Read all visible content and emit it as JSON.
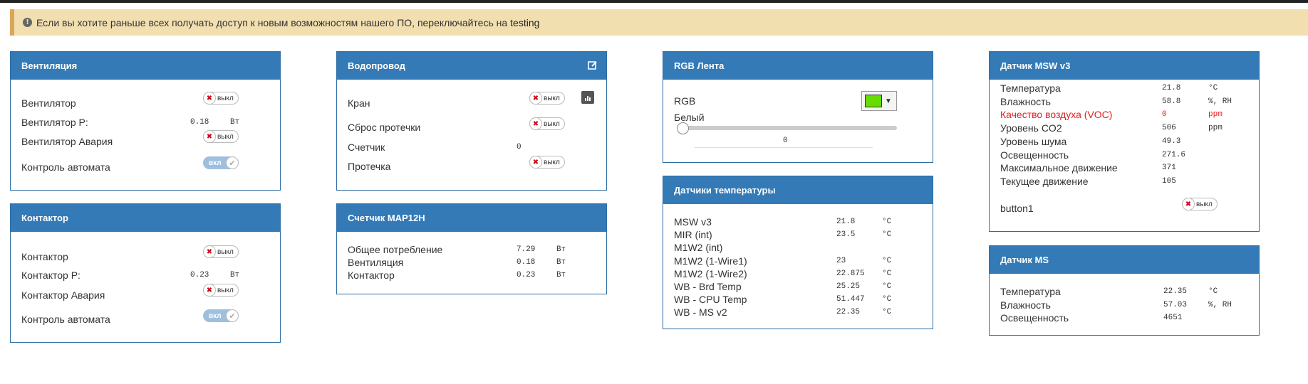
{
  "alert": {
    "text": "Если вы хотите раньше всех получать доступ к новым возможностям нашего ПО, переключайтесь на",
    "link": "testing",
    "icon": "exclamation-circle-icon"
  },
  "toggle_off_label": "выкл",
  "toggle_on_label": "вкл",
  "ventilation": {
    "title": "Вентиляция",
    "fan": "Вентилятор",
    "fan_p": "Вентилятор P:",
    "fan_p_value": "0.18",
    "fan_p_unit": "Вт",
    "fan_alarm": "Вентилятор Авария",
    "auto_control": "Контроль автомата"
  },
  "contactor": {
    "title": "Контактор",
    "contactor": "Контактор",
    "contactor_p": "Контактор P:",
    "contactor_p_value": "0.23",
    "contactor_p_unit": "Вт",
    "contactor_alarm": "Контактор Авария",
    "auto_control": "Контроль автомата"
  },
  "water": {
    "title": "Водопровод",
    "valve": "Кран",
    "reset_leak": "Сброс протечки",
    "counter": "Счетчик",
    "counter_value": "0",
    "leak": "Протечка"
  },
  "meter": {
    "title": "Счетчик MAP12H",
    "rows": [
      {
        "label": "Общее потребление",
        "value": "7.29",
        "unit": "Вт"
      },
      {
        "label": "Вентиляция",
        "value": "0.18",
        "unit": "Вт"
      },
      {
        "label": "Контактор",
        "value": "0.23",
        "unit": "Вт"
      }
    ]
  },
  "rgb": {
    "title": "RGB Лента",
    "rgb_label": "RGB",
    "color": "#66dd00",
    "white_label": "Белый",
    "white_value": "0"
  },
  "temps": {
    "title": "Датчики температуры",
    "rows": [
      {
        "label": "MSW v3",
        "value": "21.8",
        "unit": "°C"
      },
      {
        "label": "MIR (int)",
        "value": "23.5",
        "unit": "°C"
      },
      {
        "label": "M1W2 (int)",
        "value": "",
        "unit": ""
      },
      {
        "label": "M1W2 (1-Wire1)",
        "value": "23",
        "unit": "°C"
      },
      {
        "label": "M1W2 (1-Wire2)",
        "value": "22.875",
        "unit": "°C"
      },
      {
        "label": "WB - Brd Temp",
        "value": "25.25",
        "unit": "°C"
      },
      {
        "label": "WB - CPU Temp",
        "value": "51.447",
        "unit": "°C"
      },
      {
        "label": "WB - MS v2",
        "value": "22.35",
        "unit": "°C"
      }
    ]
  },
  "msw": {
    "title": "Датчик MSW v3",
    "rows": [
      {
        "label": "Температура",
        "value": "21.8",
        "unit": "°C",
        "alert": false
      },
      {
        "label": "Влажность",
        "value": "58.8",
        "unit": "%, RH",
        "alert": false
      },
      {
        "label": "Качество воздуха (VOC)",
        "value": "0",
        "unit": "ppm",
        "alert": true
      },
      {
        "label": "Уровень CO2",
        "value": "506",
        "unit": "ppm",
        "alert": false
      },
      {
        "label": "Уровень шума",
        "value": "49.3",
        "unit": "",
        "alert": false
      },
      {
        "label": "Освещенность",
        "value": "271.6",
        "unit": "",
        "alert": false
      },
      {
        "label": "Максимальное движение",
        "value": "371",
        "unit": "",
        "alert": false
      },
      {
        "label": "Текущее движение",
        "value": "105",
        "unit": "",
        "alert": false
      }
    ],
    "button1": "button1"
  },
  "ms": {
    "title": "Датчик MS",
    "rows": [
      {
        "label": "Температура",
        "value": "22.35",
        "unit": "°C"
      },
      {
        "label": "Влажность",
        "value": "57.03",
        "unit": "%, RH"
      },
      {
        "label": "Освещенность",
        "value": "4651",
        "unit": ""
      }
    ]
  }
}
